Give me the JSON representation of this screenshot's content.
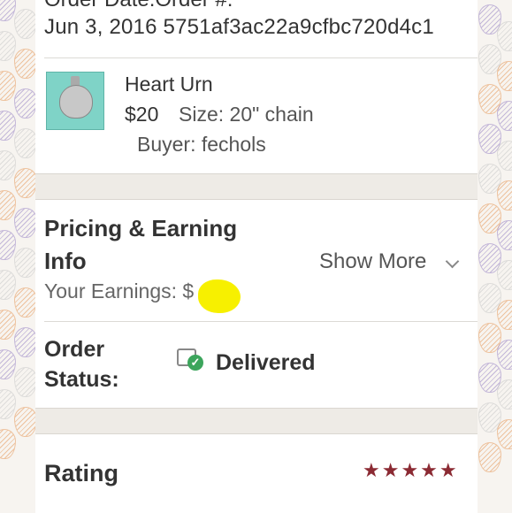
{
  "order": {
    "header_label": "Order Date:Order #:",
    "date": "Jun 3, 2016",
    "order_number": "5751af3ac22a9cfbc720d4c1"
  },
  "item": {
    "title": "Heart Urn",
    "price": "$20",
    "size": "Size: 20\" chain",
    "buyer": "Buyer: fechols",
    "thumbnail_icon": "heart-urn-pendant-image"
  },
  "pricing": {
    "title": "Pricing & Earning Info",
    "show_more_label": "Show More",
    "earnings_label": "Your Earnings: $"
  },
  "status": {
    "label": "Order Status:",
    "value": "Delivered",
    "icon": "delivered-check-icon",
    "status_color": "#3ca55c"
  },
  "rating": {
    "label": "Rating",
    "stars": "★★★★★",
    "value": 5,
    "star_color": "#8b2a33"
  }
}
